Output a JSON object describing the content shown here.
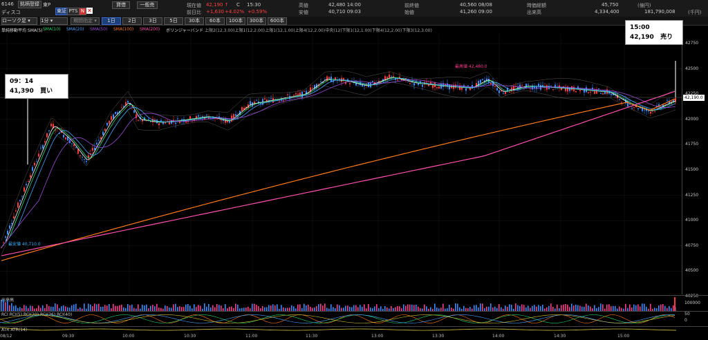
{
  "header": {
    "code": "6146",
    "btn_search": "銘柄登録",
    "market": "東P",
    "tag_higashi": "東証",
    "tag_pts": "PTS",
    "tag_n": "N",
    "btn_buy": "貸借",
    "btn_ippan": "一般売",
    "name": "ディスコ",
    "price_label": "現在値",
    "price": "42,190 ↑",
    "c_label": "C",
    "time": "15:30",
    "change_label": "前日比",
    "change": "+1,630",
    "change_pct": "+4.02%",
    "change_pct2": "+0.59%",
    "high_label": "高値",
    "high": "42,480 14:00",
    "low_label": "安値",
    "low": "40,710 09:03",
    "prev_label": "前終値",
    "prev": "40,560 08/08",
    "open_label": "始値",
    "open": "41,260 09:00",
    "mcap_label": "時価総額",
    "mcap": "45,750",
    "mcap_unit": "(億円)",
    "volume_label": "出来高",
    "volume": "4,334,400",
    "value": "181,790,008",
    "value_unit": "(千円)"
  },
  "toolbar": {
    "chart_type": "ローソク足",
    "interval": "1分",
    "period": "期間指定",
    "tabs": [
      "1日",
      "2日",
      "3日",
      "5日",
      "30本",
      "60本",
      "100本",
      "300本",
      "600本"
    ],
    "active_tab": "1日"
  },
  "indicators": {
    "title": "単純移動平均 SMA(5)",
    "items": [
      {
        "label": "SMA(10)",
        "color": "#27d36b"
      },
      {
        "label": "SMA(20)",
        "color": "#4aa3ff"
      },
      {
        "label": "SMA(50)",
        "color": "#9b4dd6"
      },
      {
        "label": "SMA(100)",
        "color": "#ff7a1a"
      },
      {
        "label": "SMA(200)",
        "color": "#ff4fae"
      }
    ],
    "bollinger": "ボリンジャーバンド",
    "bands": [
      "上限2(12,3.00)",
      "上限1(12,2.00)",
      "上限1(12,1.00)",
      "上限4(12,2.00)",
      "中央(12)",
      "下限1(12,1.00)",
      "下限4(12,2.00)",
      "下限3(12,3.00)"
    ]
  },
  "chart_data": {
    "type": "candlestick",
    "y_ticks": [
      "42750",
      "42500",
      "42250",
      "42000",
      "41750",
      "41500",
      "41250",
      "41000",
      "40750",
      "40500",
      "40250"
    ],
    "x_ticks": [
      "08/12",
      "09:30",
      "10:00",
      "10:30",
      "11:00",
      "11:30",
      "13:00",
      "13:30",
      "14:00",
      "14:30",
      "15:00"
    ],
    "high_annotation": "最高値 42,480.0",
    "low_annotation": "最安値 40,710.0",
    "last_price_label": "42,190.0",
    "volume_label": "出来高",
    "volume_tick": "100000",
    "osc_label": "RCI RCI(5) RCI(20) RCI(26) RCI(40)",
    "osc_ticks": [
      "50",
      "0"
    ],
    "atr_label": "ATR ATR(14)",
    "sma_colors": [
      "#ffffff",
      "#27d36b",
      "#4aa3ff",
      "#9b4dd6",
      "#ff7a1a",
      "#ff4fae"
    ]
  },
  "annotations": {
    "buy": {
      "time": "09：14",
      "price": "41,390",
      "action": "買い"
    },
    "sell": {
      "time": "15:00",
      "price": "42,190",
      "action": "売り"
    }
  }
}
